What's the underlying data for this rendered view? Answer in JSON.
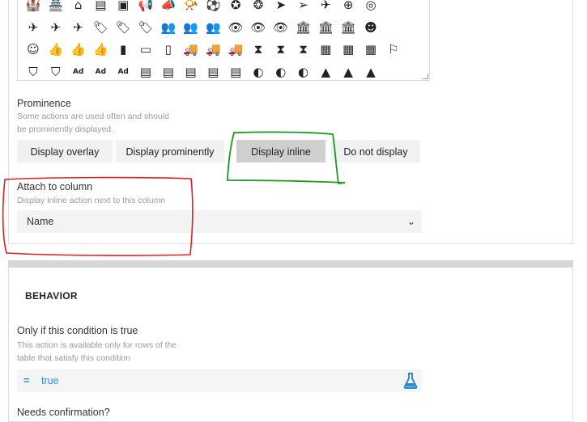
{
  "icon_grid": {
    "rows": [
      [
        "🏰",
        "🏯",
        "⌂",
        "▤",
        "▣",
        "📢",
        "📣",
        "📯",
        "⚽",
        "✪",
        "❂",
        "➤",
        "➢",
        "✈",
        "⊕",
        "◎"
      ],
      [
        "✈",
        "✈",
        "✈",
        "🏷",
        "🏷",
        "🏷",
        "👥",
        "👥",
        "👥",
        "👁",
        "👁",
        "👁",
        "🏛",
        "🏛",
        "🏛",
        "☻"
      ],
      [
        "☺",
        "👍",
        "👍",
        "👍",
        "▮",
        "▭",
        "▯",
        "🚚",
        "🚚",
        "🚚",
        "⧗",
        "⧗",
        "⧗",
        "▦",
        "▦",
        "▦",
        "⚐"
      ],
      [
        "⛉",
        "⛉",
        "Ad",
        "Ad",
        "Ad",
        "▤",
        "▤",
        "▤",
        "▤",
        "▤",
        "◐",
        "◐",
        "◐",
        "▲",
        "▲",
        "▲"
      ]
    ]
  },
  "prominence": {
    "label": "Prominence",
    "help": "Some actions are used often and should be prominently displayed.",
    "options": [
      "Display overlay",
      "Display prominently",
      "Display inline",
      "Do not display"
    ],
    "selected": "Display inline"
  },
  "attach": {
    "label": "Attach to column",
    "help": "Display inline action next to this column",
    "value": "Name"
  },
  "behavior": {
    "title": "BEHAVIOR",
    "condition_label": "Only if this condition is true",
    "condition_help": "This action is available only for rows of the table that satisfy this condition",
    "condition_eq": "=",
    "condition_value": "true",
    "confirmation_label": "Needs confirmation?"
  },
  "colors": {
    "accent": "#2a8fd1",
    "annotation_red": "#e02020",
    "annotation_green": "#1a9a1a"
  }
}
